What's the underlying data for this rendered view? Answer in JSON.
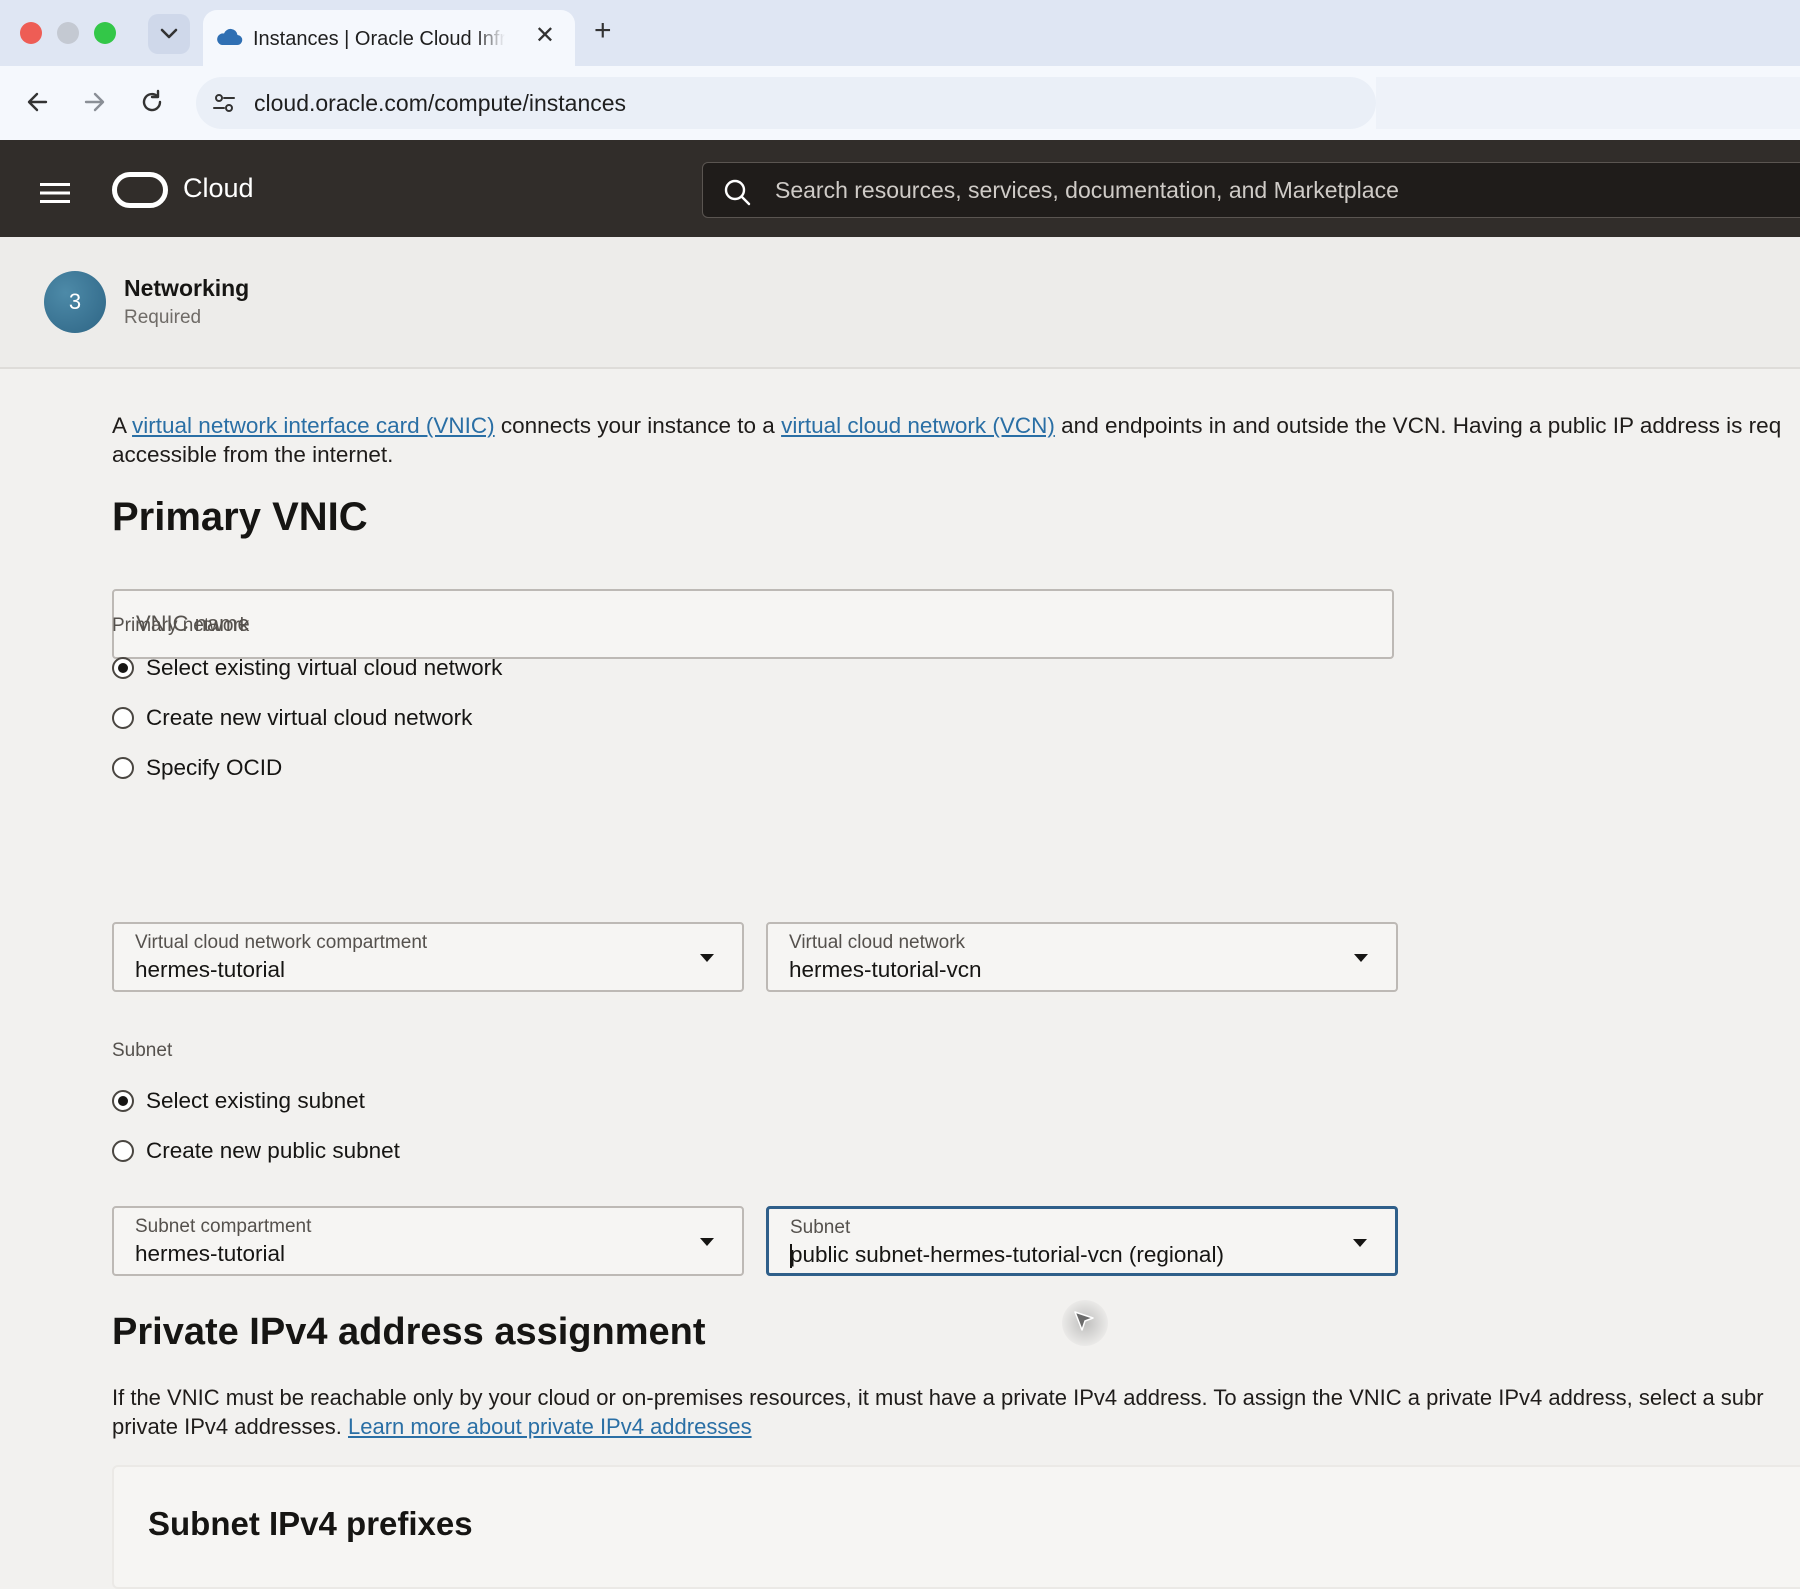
{
  "browser": {
    "tab_title": "Instances | Oracle Cloud Infrastructure",
    "tab_close": "✕",
    "new_tab": "+",
    "url": "cloud.oracle.com/compute/instances"
  },
  "header": {
    "brand": "Cloud",
    "search_placeholder": "Search resources, services, documentation, and Marketplace"
  },
  "step": {
    "number": "3",
    "title": "Networking",
    "subtitle": "Required"
  },
  "intro": {
    "t1": "A ",
    "link1": "virtual network interface card (VNIC)",
    "t2": " connects your instance to a ",
    "link2": "virtual cloud network (VCN)",
    "t3": " and endpoints in and outside the VCN. Having a public IP address is req",
    "line2": "accessible from the internet."
  },
  "primary_vnic": {
    "heading": "Primary VNIC",
    "vnic_name_placeholder": "VNIC name",
    "network_label": "Primary network",
    "network_options": [
      {
        "label": "Select existing virtual cloud network",
        "checked": true
      },
      {
        "label": "Create new virtual cloud network",
        "checked": false
      },
      {
        "label": "Specify OCID",
        "checked": false
      }
    ],
    "vcn_compartment": {
      "label": "Virtual cloud network compartment",
      "value": "hermes-tutorial"
    },
    "vcn": {
      "label": "Virtual cloud network",
      "value": "hermes-tutorial-vcn"
    },
    "subnet_label": "Subnet",
    "subnet_options": [
      {
        "label": "Select existing subnet",
        "checked": true
      },
      {
        "label": "Create new public subnet",
        "checked": false
      }
    ],
    "subnet_compartment": {
      "label": "Subnet compartment",
      "value": "hermes-tutorial"
    },
    "subnet": {
      "label": "Subnet",
      "value": "public subnet-hermes-tutorial-vcn (regional)"
    }
  },
  "private_ipv4": {
    "heading": "Private IPv4 address assignment",
    "desc1": "If the VNIC must be reachable only by your cloud or on-premises resources, it must have a private IPv4 address. To assign the VNIC a private IPv4 address, select a subr",
    "desc2": "private IPv4 addresses. ",
    "learn_more": "Learn more about private IPv4 addresses",
    "card_heading": "Subnet IPv4 prefixes"
  },
  "colors": {
    "header_bg": "#312d2a",
    "link": "#2a6fa5",
    "step_circle": "#2e6585",
    "focus_border": "#2f5f8a"
  }
}
